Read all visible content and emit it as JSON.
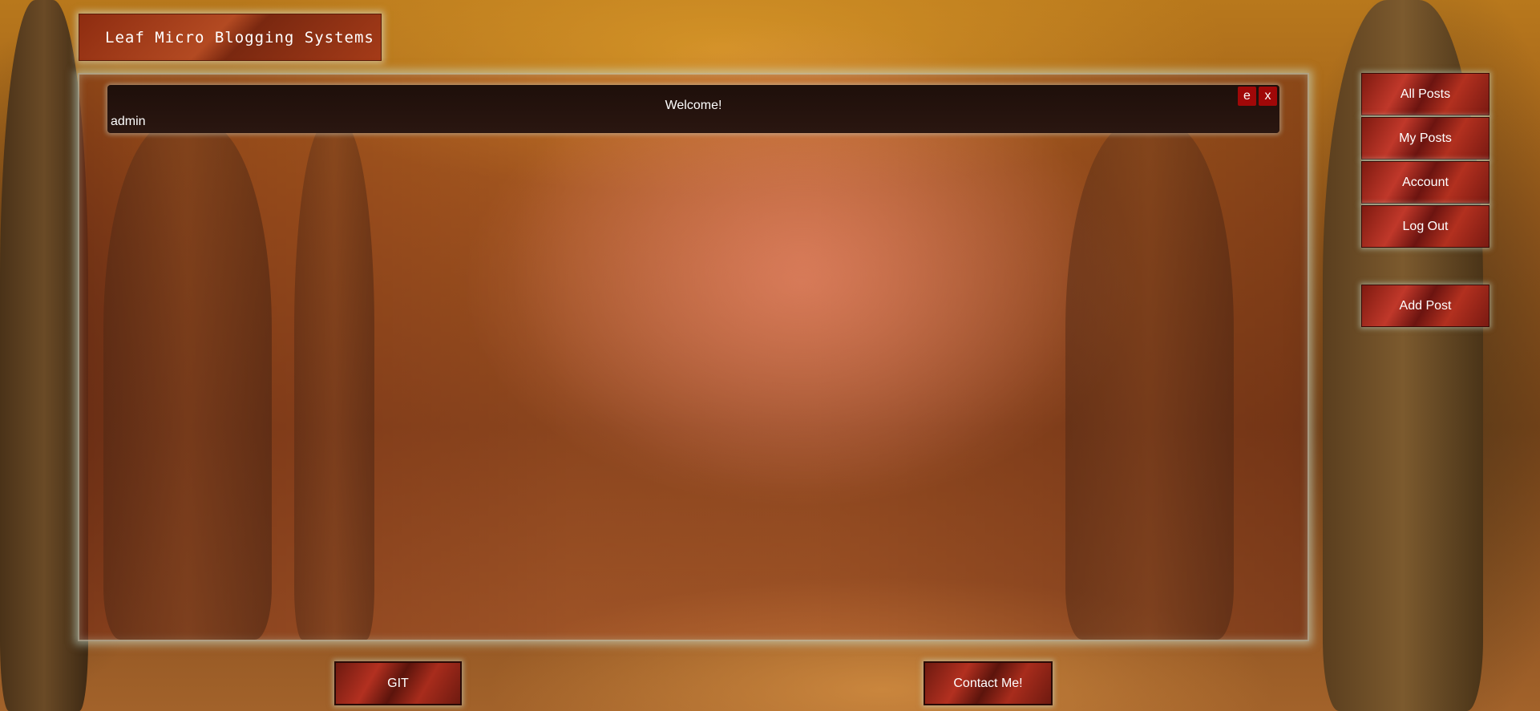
{
  "site": {
    "title": "Leaf Micro Blogging Systems"
  },
  "post": {
    "title": "Welcome!",
    "author": "admin",
    "edit_label": "e",
    "delete_label": "x"
  },
  "nav": {
    "all_posts": "All Posts",
    "my_posts": "My Posts",
    "account": "Account",
    "log_out": "Log Out",
    "add_post": "Add Post"
  },
  "footer": {
    "git": "GIT",
    "contact": "Contact Me!"
  },
  "colors": {
    "accent": "#a00808",
    "card_bg": "#1e0f0a"
  }
}
